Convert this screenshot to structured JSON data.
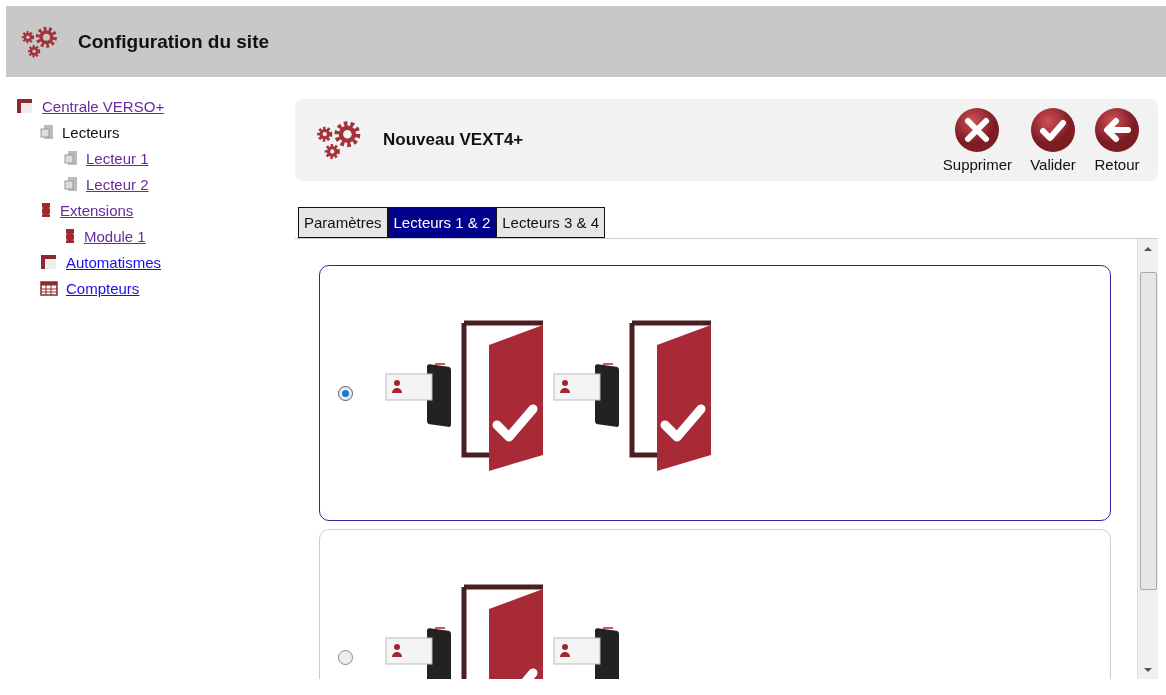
{
  "header": {
    "title": "Configuration du site"
  },
  "sidebar": {
    "tree": [
      {
        "label": "Centrale VERSO+",
        "kind": "central",
        "link": true,
        "visited": true,
        "children": [
          {
            "label": "Lecteurs",
            "kind": "reader",
            "link": false,
            "visited": false,
            "children": [
              {
                "label": "Lecteur 1",
                "kind": "reader",
                "link": true,
                "visited": true
              },
              {
                "label": "Lecteur 2",
                "kind": "reader",
                "link": true,
                "visited": true
              }
            ]
          },
          {
            "label": "Extensions",
            "kind": "module",
            "link": true,
            "visited": true,
            "children": [
              {
                "label": "Module 1",
                "kind": "module",
                "link": true,
                "visited": true
              }
            ]
          },
          {
            "label": "Automatismes",
            "kind": "central",
            "link": true,
            "visited": false
          },
          {
            "label": "Compteurs",
            "kind": "counter",
            "link": true,
            "visited": false
          }
        ]
      }
    ]
  },
  "panel": {
    "title": "Nouveau VEXT4+",
    "actions": [
      {
        "label": "Supprimer",
        "kind": "delete"
      },
      {
        "label": "Valider",
        "kind": "confirm"
      },
      {
        "label": "Retour",
        "kind": "back"
      }
    ]
  },
  "tabs": [
    {
      "label": "Paramètres",
      "selected": false
    },
    {
      "label": "Lecteurs 1 & 2",
      "selected": true
    },
    {
      "label": "Lecteurs 3 & 4",
      "selected": false
    }
  ],
  "options": [
    {
      "selected": true,
      "items": [
        {
          "kind": "reader"
        },
        {
          "kind": "door"
        },
        {
          "kind": "reader"
        },
        {
          "kind": "door"
        }
      ]
    },
    {
      "selected": false,
      "items": [
        {
          "kind": "reader"
        },
        {
          "kind": "door"
        },
        {
          "kind": "reader"
        }
      ]
    }
  ]
}
